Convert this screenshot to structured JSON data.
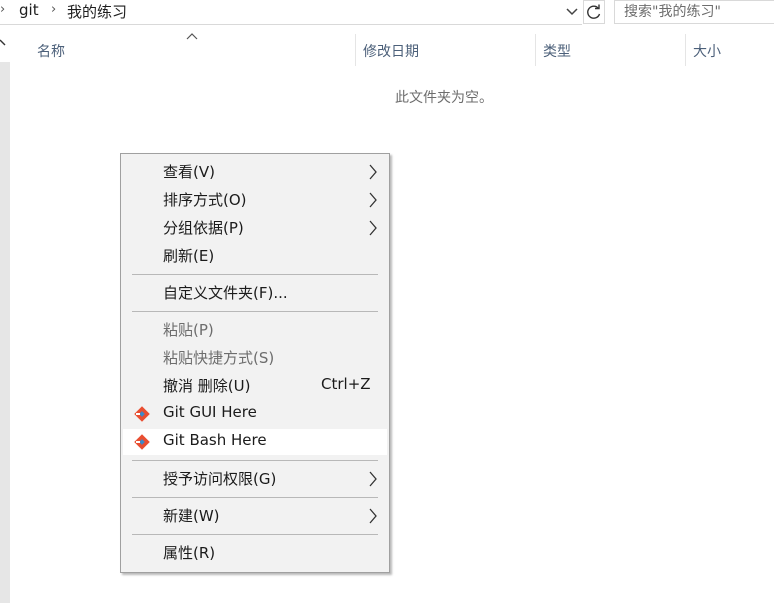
{
  "address_bar": {
    "crumbs": [
      "git",
      "我的练习"
    ],
    "search_placeholder": "搜索\"我的练习\""
  },
  "columns": [
    "名称",
    "修改日期",
    "类型",
    "大小"
  ],
  "empty_message": "此文件夹为空。",
  "context_menu": {
    "view": "查看(V)",
    "sort_by": "排序方式(O)",
    "group_by": "分组依据(P)",
    "refresh": "刷新(E)",
    "customize_folder": "自定义文件夹(F)...",
    "paste": "粘贴(P)",
    "paste_shortcut": "粘贴快捷方式(S)",
    "undo_delete": "撤消 删除(U)",
    "undo_delete_shortcut": "Ctrl+Z",
    "git_gui": "Git GUI Here",
    "git_bash": "Git Bash Here",
    "give_access": "授予访问权限(G)",
    "new": "新建(W)",
    "properties": "属性(R)"
  },
  "colors": {
    "git_icon_red": "#e94e31",
    "git_icon_blue": "#3f88c8",
    "header_text": "#4c607a"
  }
}
